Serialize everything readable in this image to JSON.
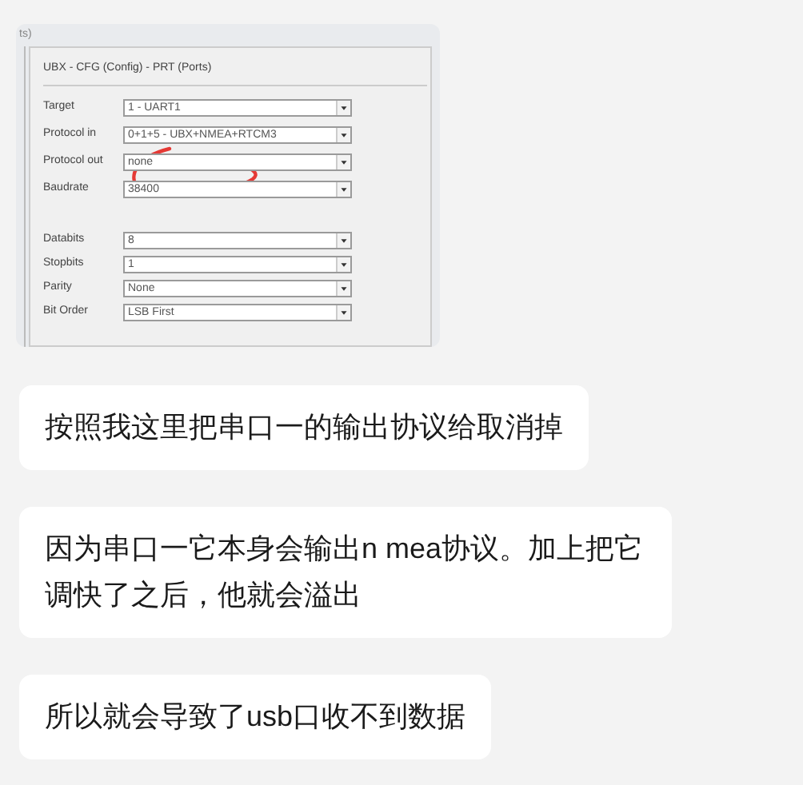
{
  "shared_image": {
    "tab_fragment": "ts)",
    "panel_title": "UBX - CFG (Config) - PRT (Ports)",
    "field_groups": [
      [
        {
          "label": "Target",
          "value": "1 - UART1"
        },
        {
          "label": "Protocol in",
          "value": "0+1+5 - UBX+NMEA+RTCM3"
        },
        {
          "label": "Protocol out",
          "value": "none"
        },
        {
          "label": "Baudrate",
          "value": "38400"
        }
      ],
      [
        {
          "label": "Databits",
          "value": "8"
        },
        {
          "label": "Stopbits",
          "value": "1"
        },
        {
          "label": "Parity",
          "value": "None"
        },
        {
          "label": "Bit Order",
          "value": "LSB First"
        }
      ]
    ]
  },
  "messages": [
    {
      "text": "按照我这里把串口一的输出协议给取消掉"
    },
    {
      "text": "因为串口一它本身会输出n mea协议。加上把它调快了之后，他就会溢出"
    },
    {
      "text": "所以就会导致了usb口收不到数据"
    }
  ]
}
